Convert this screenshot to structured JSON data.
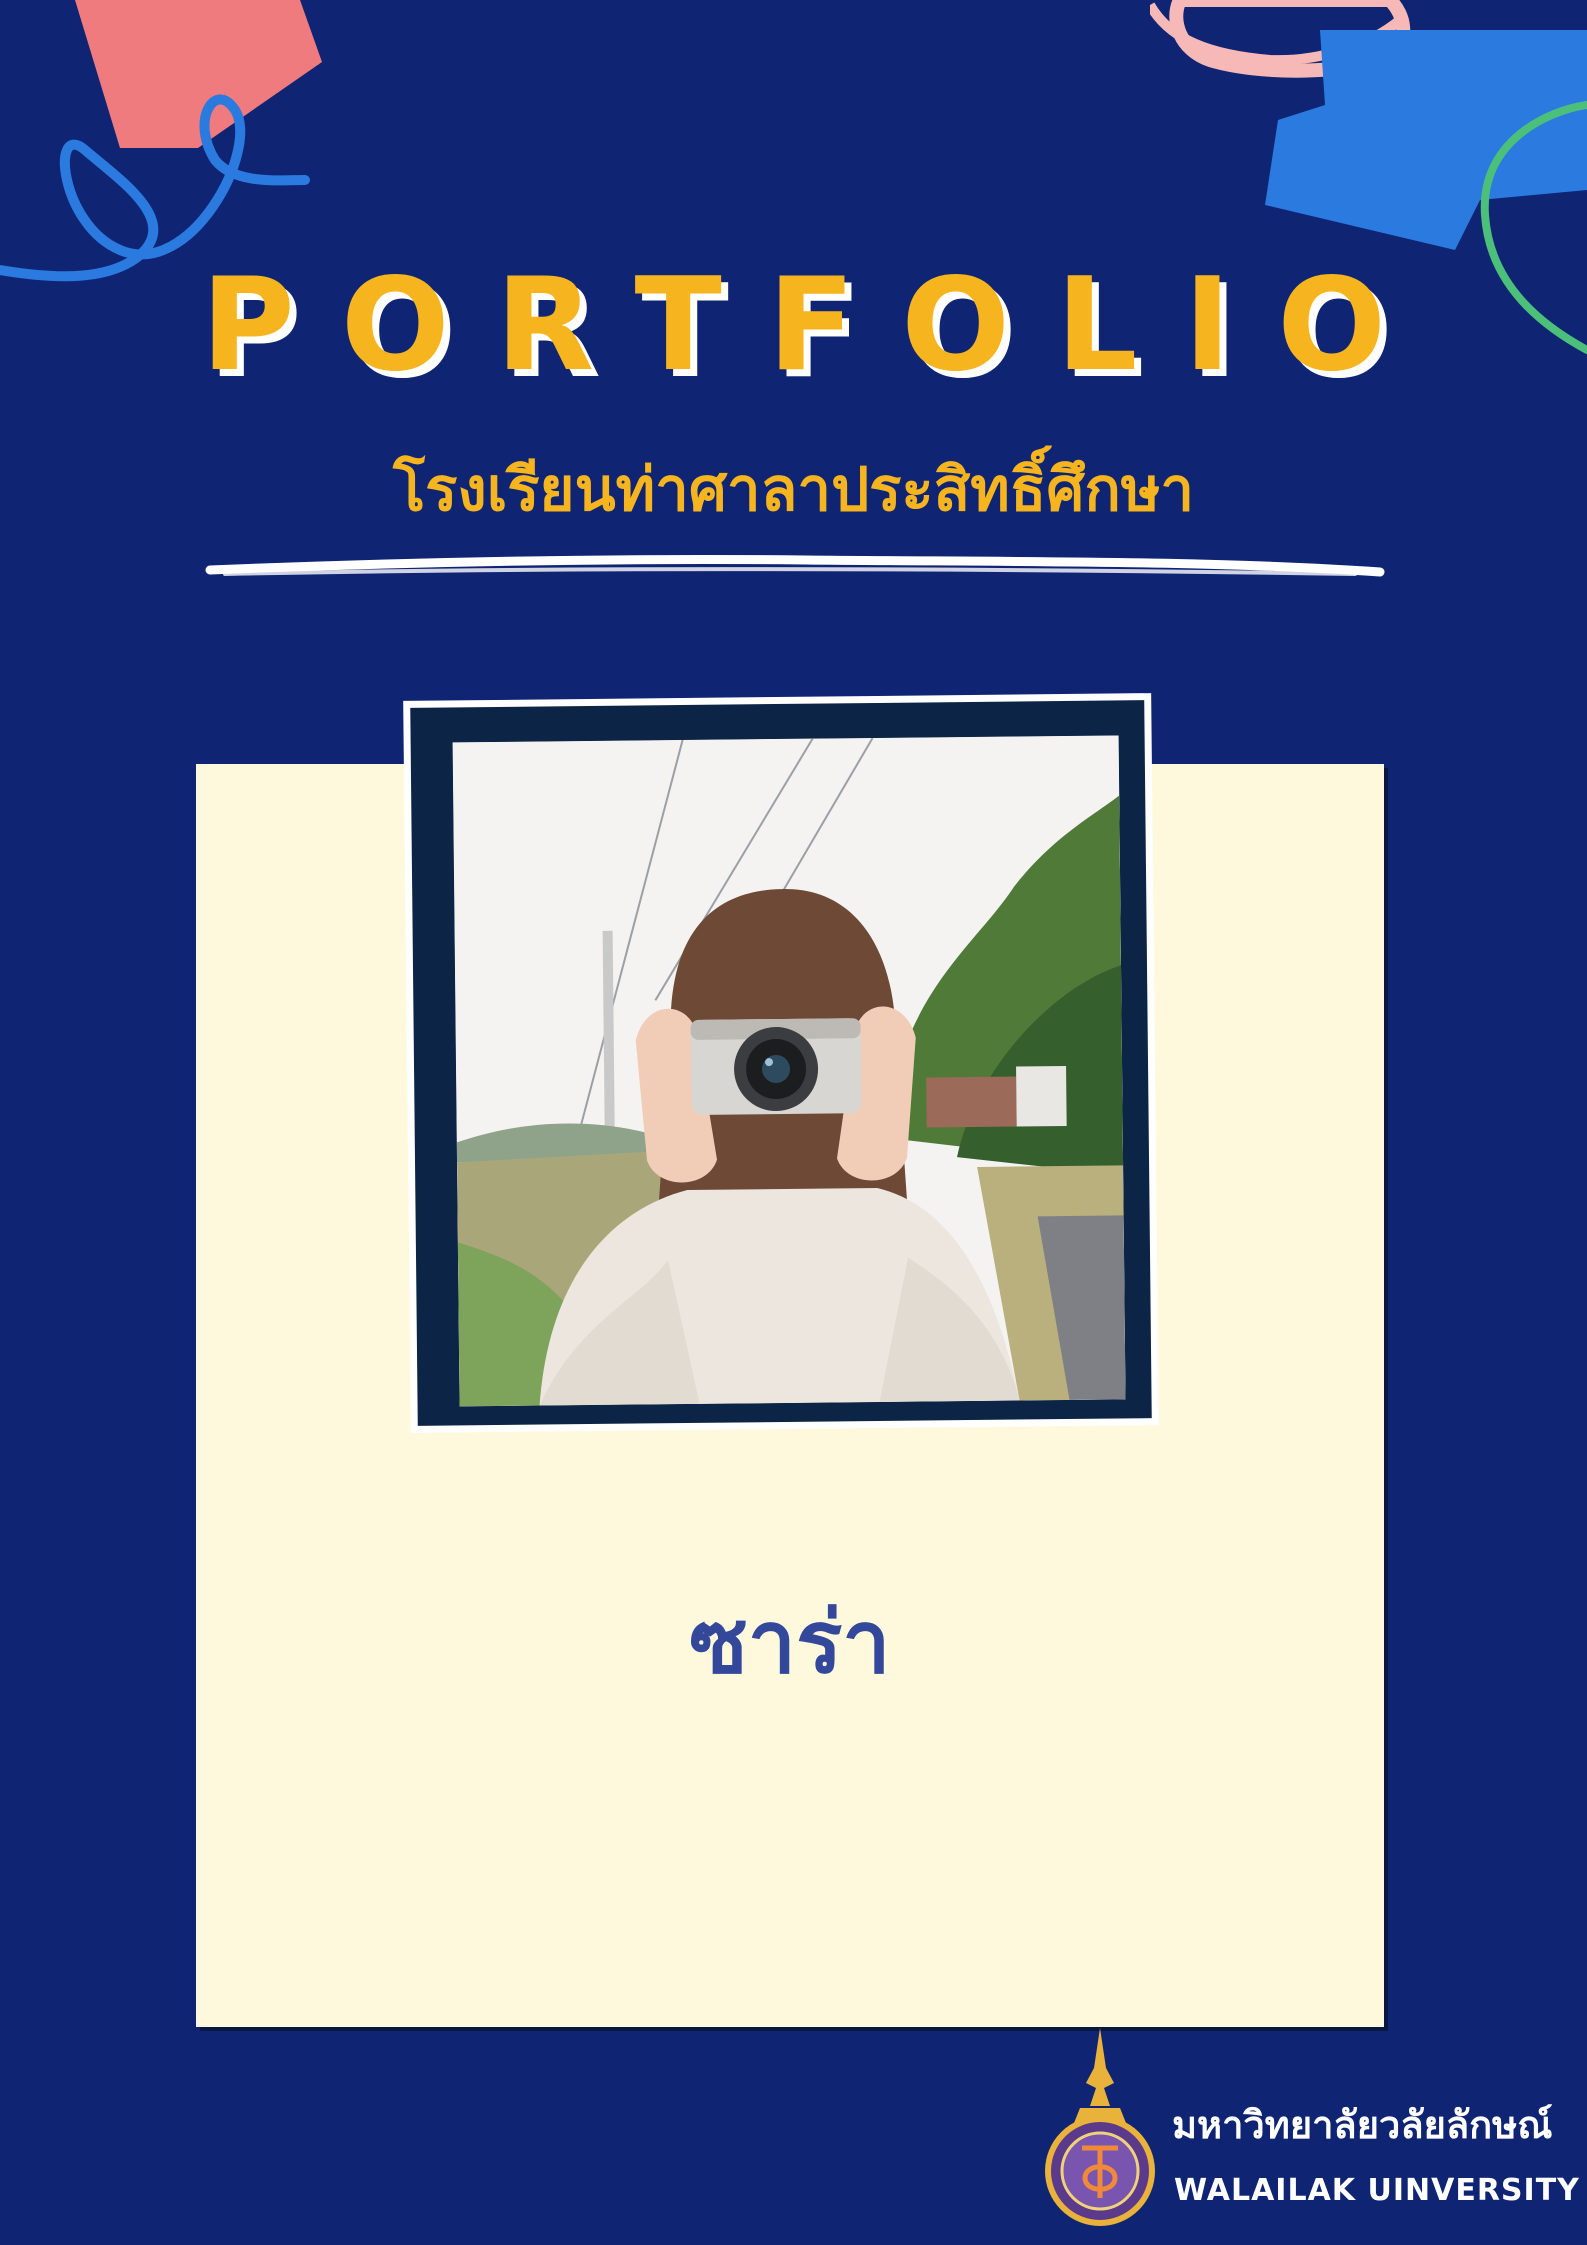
{
  "cover": {
    "title": "PORTFOLIO",
    "school_name": "โรงเรียนท่าศาลาประสิทธิ์ศึกษา",
    "student_name": "ซาร่า"
  },
  "photo": {
    "subject": "girl holding camera"
  },
  "footer": {
    "university_th": "มหาวิทยาลัยวลัยลักษณ์",
    "university_en": "WALAILAK UINVERSITY"
  },
  "colors": {
    "background": "#0f2574",
    "title": "#f6b51e",
    "card": "#fef9dc",
    "name": "#33489a",
    "frame": "#0c2547",
    "deco_pink": "#f07b7e",
    "deco_blue": "#2a7ae0",
    "deco_green": "#4cc07a",
    "deco_lightpink": "#f7b9b8"
  }
}
